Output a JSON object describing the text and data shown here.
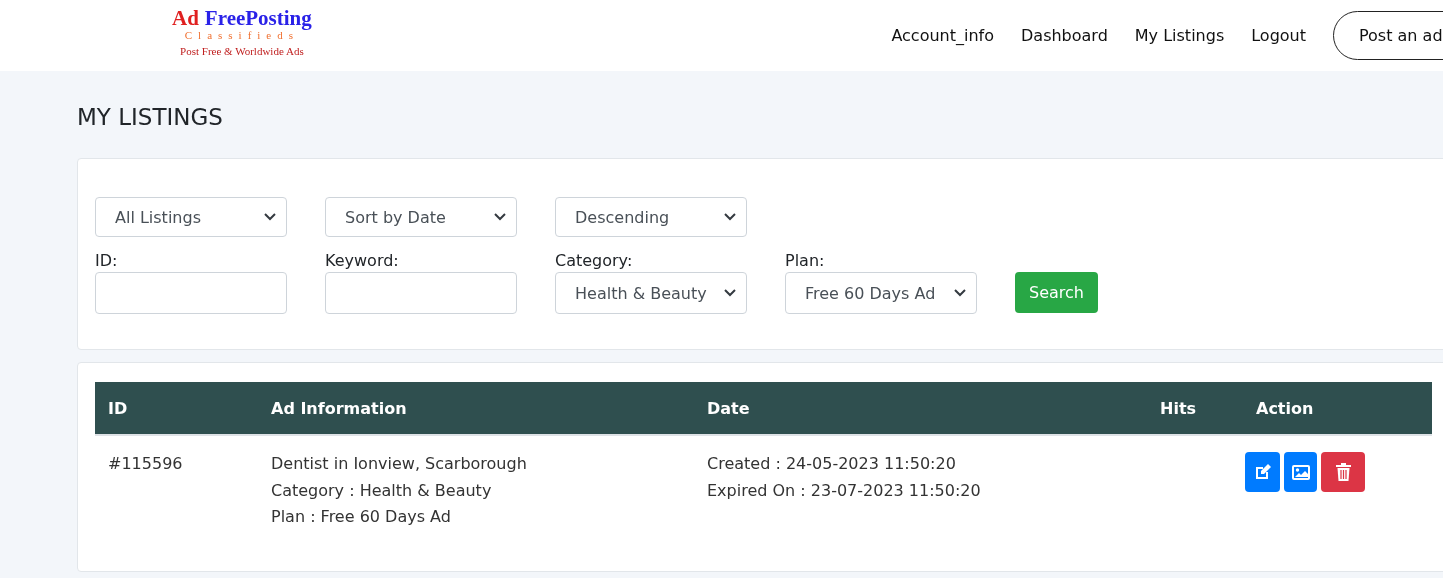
{
  "logo": {
    "word_1": "Ad",
    "word_2": "FreePosting",
    "subtitle": "Classifieds",
    "tagline": "Post Free & Worldwide Ads"
  },
  "nav": [
    "Account_info",
    "Dashboard",
    "My Listings",
    "Logout"
  ],
  "post_button": "Post an ad",
  "title": "MY LISTINGS",
  "filters": {
    "selects": [
      "All Listings",
      "Sort by Date",
      "Descending"
    ],
    "fields": [
      {
        "kind": "input",
        "label": "ID:"
      },
      {
        "kind": "input",
        "label": "Keyword:"
      },
      {
        "kind": "select",
        "label": "Category:",
        "value": "Health & Beauty"
      },
      {
        "kind": "select",
        "label": "Plan:",
        "value": "Free 60 Days Ad"
      }
    ],
    "search_button": "Search"
  },
  "table": {
    "columns": [
      "ID",
      "Ad Information",
      "Date",
      "Hits",
      "Action"
    ],
    "rows": [
      {
        "id": "#115596",
        "info": [
          "Dentist in Ionview, Scarborough",
          "Category : Health & Beauty",
          "Plan : Free 60 Days Ad"
        ],
        "date": [
          "Created : 24-05-2023 11:50:20",
          "Expired On : 23-07-2023 11:50:20"
        ],
        "hits": ""
      }
    ]
  }
}
